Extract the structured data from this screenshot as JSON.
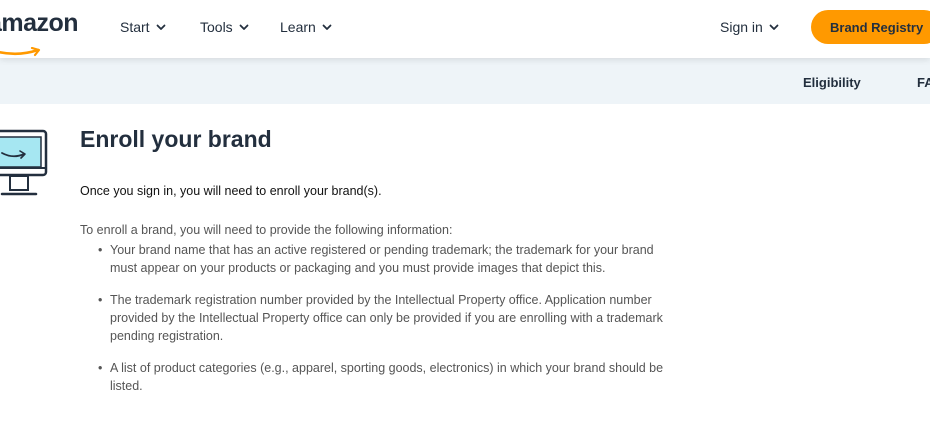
{
  "header": {
    "logo_text": "amazon",
    "nav": [
      {
        "label": "Start"
      },
      {
        "label": "Tools"
      },
      {
        "label": "Learn"
      }
    ],
    "sign_in": "Sign in",
    "cta_label": "Brand Registry"
  },
  "subnav": {
    "links": [
      {
        "label": "Eligibility"
      },
      {
        "label": "FA"
      }
    ]
  },
  "main": {
    "icon": "monitor-icon",
    "heading": "Enroll your brand",
    "intro": "Once you sign in, you will need to enroll your brand(s).",
    "lead": "To enroll a brand, you will need to provide the following information:",
    "bullets": [
      "Your brand name that has an active registered or pending trademark; the trademark for your brand must appear on your products or packaging and you must provide images that depict this.",
      "The trademark registration number provided by the Intellectual Property office. Application number provided by the Intellectual Property office can only be provided if you are enrolling with a trademark pending registration.",
      "A list of product categories (e.g., apparel, sporting goods, electronics) in which your brand should be listed."
    ]
  },
  "colors": {
    "accent": "#ff9900",
    "ink": "#232f3e",
    "subnav_bg": "#eef4f8",
    "monitor_screen": "#a6e7f2"
  }
}
